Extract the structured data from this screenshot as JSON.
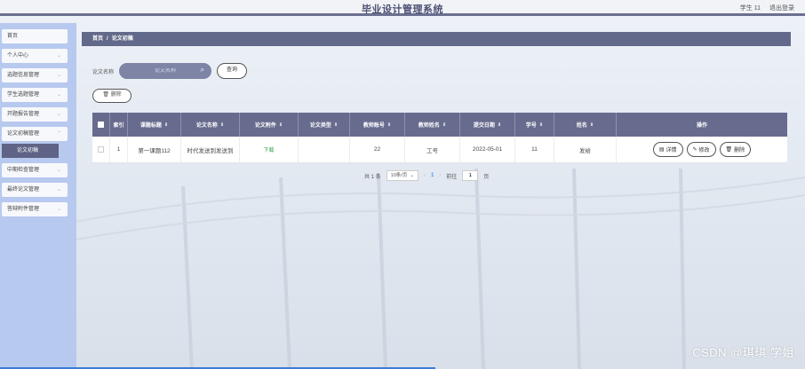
{
  "app": {
    "title": "毕业设计管理系统",
    "user_label": "学生 11",
    "logout_label": "退出登录"
  },
  "sidebar": {
    "items": [
      {
        "label": "首页"
      },
      {
        "label": "个人中心"
      },
      {
        "label": "选题信息管理"
      },
      {
        "label": "学生选题管理"
      },
      {
        "label": "开题报告管理"
      },
      {
        "label": "论文初稿管理"
      },
      {
        "label": "中期检查管理"
      },
      {
        "label": "最终论文管理"
      },
      {
        "label": "答辩附件管理"
      }
    ],
    "active_sub": "论文初稿"
  },
  "breadcrumb": {
    "home": "首页",
    "separator": "/",
    "current": "论文初稿"
  },
  "search": {
    "label": "论文名称",
    "placeholder": "论文名称",
    "query_button": "查询"
  },
  "toolbar": {
    "delete_label": "删除"
  },
  "table": {
    "headers": [
      "索引",
      "课题标题",
      "论文名称",
      "论文附件",
      "论文类型",
      "教师账号",
      "教师姓名",
      "提交日期",
      "学号",
      "姓名",
      "操作"
    ],
    "rows": [
      {
        "index": "1",
        "topic": "第一课题112",
        "paper_name": "时代发送到发送到",
        "attachment": "下载",
        "paper_type": "",
        "teacher_account": "22",
        "teacher_name": "工号",
        "submit_date": "2022-05-01",
        "student_no": "11",
        "student_name": "发给",
        "actions": {
          "detail": "详情",
          "edit": "修改",
          "delete": "删除"
        }
      }
    ]
  },
  "pagination": {
    "total": "共 1 条",
    "page_size": "10条/页",
    "current_page": "1",
    "goto_label": "前往",
    "goto_value": "1",
    "page_suffix": "页"
  },
  "watermark": "CSDN @琪琪 学姐",
  "colors": {
    "header_bar": "#63698a",
    "sidebar": "#b7c9ee",
    "active_menu": "#5f6386",
    "download_link": "#3aa655"
  }
}
